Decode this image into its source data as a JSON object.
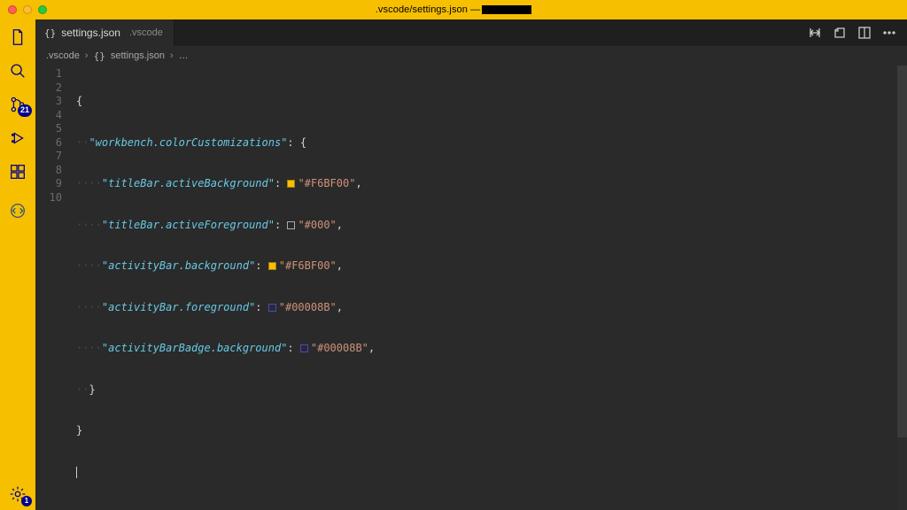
{
  "titlebar": {
    "path": ".vscode/settings.json —"
  },
  "activitybar": {
    "scm_badge": "21",
    "settings_badge": "1"
  },
  "tab": {
    "filename": "settings.json",
    "dir": ".vscode",
    "braces": "{}"
  },
  "breadcrumbs": {
    "seg1": ".vscode",
    "seg2": "settings.json",
    "seg3": "…",
    "braces": "{}",
    "chev": "›"
  },
  "gutter": [
    "1",
    "2",
    "3",
    "4",
    "5",
    "6",
    "7",
    "8",
    "9",
    "10"
  ],
  "code": {
    "l1": {
      "open": "{"
    },
    "l2": {
      "key": "\"workbench.colorCustomizations\"",
      "post": ": {"
    },
    "l3": {
      "key": "\"titleBar.activeBackground\"",
      "val": "\"#F6BF00\"",
      "comma": ","
    },
    "l4": {
      "key": "\"titleBar.activeForeground\"",
      "val": "\"#000\"",
      "comma": ","
    },
    "l5": {
      "key": "\"activityBar.background\"",
      "val": "\"#F6BF00\"",
      "comma": ","
    },
    "l6": {
      "key": "\"activityBar.foreground\"",
      "val": "\"#00008B\"",
      "comma": ","
    },
    "l7": {
      "key": "\"activityBarBadge.background\"",
      "val": "\"#00008B\"",
      "comma": ","
    },
    "l8": {
      "close": "}"
    },
    "l9": {
      "close": "}"
    },
    "ws2": "··",
    "ws4": "····"
  }
}
